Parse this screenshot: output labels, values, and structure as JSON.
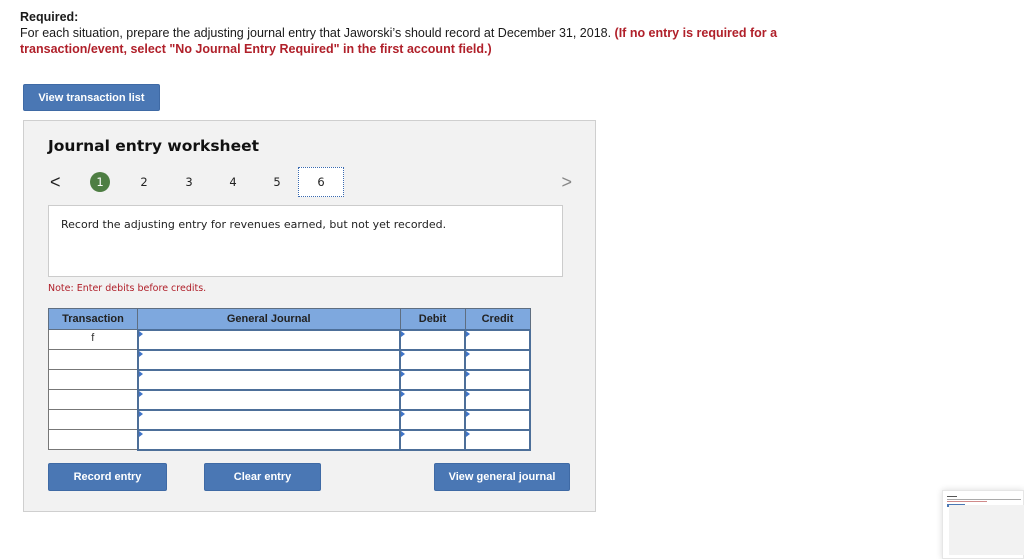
{
  "required": {
    "title": "Required:",
    "instruction": "For each situation, prepare the adjusting journal entry that Jaworski’s should record at December 31, 2018. ",
    "instruction_highlight": "(If no entry is required for a transaction/event, select \"No Journal Entry Required\" in the first account field.)"
  },
  "view_transaction_list_label": "View transaction list",
  "worksheet": {
    "title": "Journal entry worksheet",
    "pager": {
      "prev_icon": "chevron-left-icon",
      "next_icon": "chevron-right-icon",
      "prev_glyph": "<",
      "next_glyph": ">",
      "pages": [
        "1",
        "2",
        "3",
        "4",
        "5",
        "6"
      ],
      "completed_page": "1",
      "focused_page": "6"
    },
    "prompt": "Record the adjusting entry for revenues earned, but not yet recorded.",
    "note": "Note: Enter debits before credits.",
    "table": {
      "headers": [
        "Transaction",
        "General Journal",
        "Debit",
        "Credit"
      ],
      "rows": [
        {
          "transaction": "f",
          "account": "",
          "debit": "",
          "credit": ""
        },
        {
          "transaction": "",
          "account": "",
          "debit": "",
          "credit": ""
        },
        {
          "transaction": "",
          "account": "",
          "debit": "",
          "credit": ""
        },
        {
          "transaction": "",
          "account": "",
          "debit": "",
          "credit": ""
        },
        {
          "transaction": "",
          "account": "",
          "debit": "",
          "credit": ""
        },
        {
          "transaction": "",
          "account": "",
          "debit": "",
          "credit": ""
        }
      ]
    },
    "buttons": {
      "record": "Record entry",
      "clear": "Clear entry",
      "view_journal": "View general journal"
    }
  },
  "colors": {
    "button_blue": "#4a77b4",
    "header_blue": "#7ea8de",
    "warning_red": "#b0202a",
    "completed_green": "#4e7e43"
  }
}
